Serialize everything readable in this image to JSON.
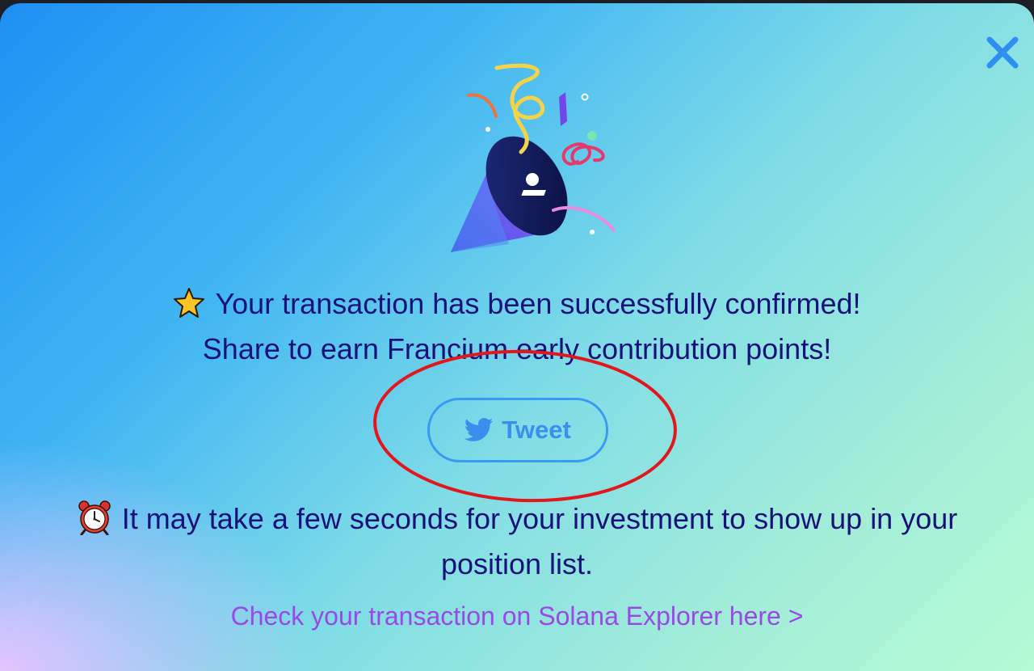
{
  "modal": {
    "close_icon": "close-icon",
    "illustration_icon": "party-popper-icon",
    "confirm_emoji": "star-icon",
    "confirm_text": "Your transaction has been successfully confirmed!",
    "share_text": "Share to earn Francium early contribution points!",
    "tweet_icon": "twitter-icon",
    "tweet_label": "Tweet",
    "notice_emoji": "alarm-clock-icon",
    "notice_text": "It may take a few seconds for your investment to show up in your position list.",
    "explorer_link": "Check your transaction on Solana Explorer here >"
  },
  "colors": {
    "text_primary": "#17127a",
    "tweet_accent": "#3a9af2",
    "link": "#9a49e6",
    "highlight_annotation": "#e3161d",
    "close_icon": "#2f8ff0"
  }
}
